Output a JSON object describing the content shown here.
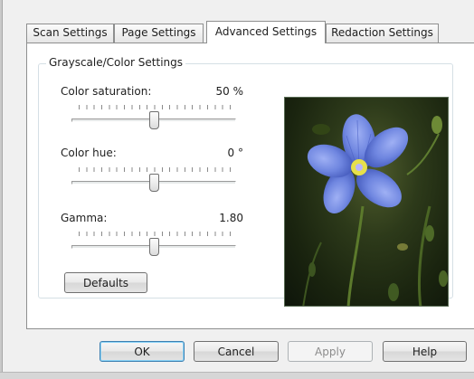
{
  "tabs": [
    {
      "label": "Scan Settings",
      "active": false
    },
    {
      "label": "Page Settings",
      "active": false
    },
    {
      "label": "Advanced Settings",
      "active": true
    },
    {
      "label": "Redaction Settings",
      "active": false
    }
  ],
  "group": {
    "title": "Grayscale/Color Settings",
    "color_saturation": {
      "label": "Color saturation:",
      "value": "50 %",
      "level": 0.5
    },
    "color_hue": {
      "label": "Color hue:",
      "value": "0 °",
      "level": 0.5
    },
    "gamma": {
      "label": "Gamma:",
      "value": "1.80",
      "level": 0.5
    },
    "defaults_label": "Defaults"
  },
  "preview": {
    "icon": "flower-photo",
    "colors": {
      "petal": "#6f86e0",
      "background": "#1a240f",
      "center": "#e6e04a"
    }
  },
  "buttons": {
    "ok": "OK",
    "cancel": "Cancel",
    "apply": "Apply",
    "help": "Help"
  },
  "colors": {
    "default_button_border": "#3c7fb1",
    "tab_border": "#8e8f8f"
  }
}
